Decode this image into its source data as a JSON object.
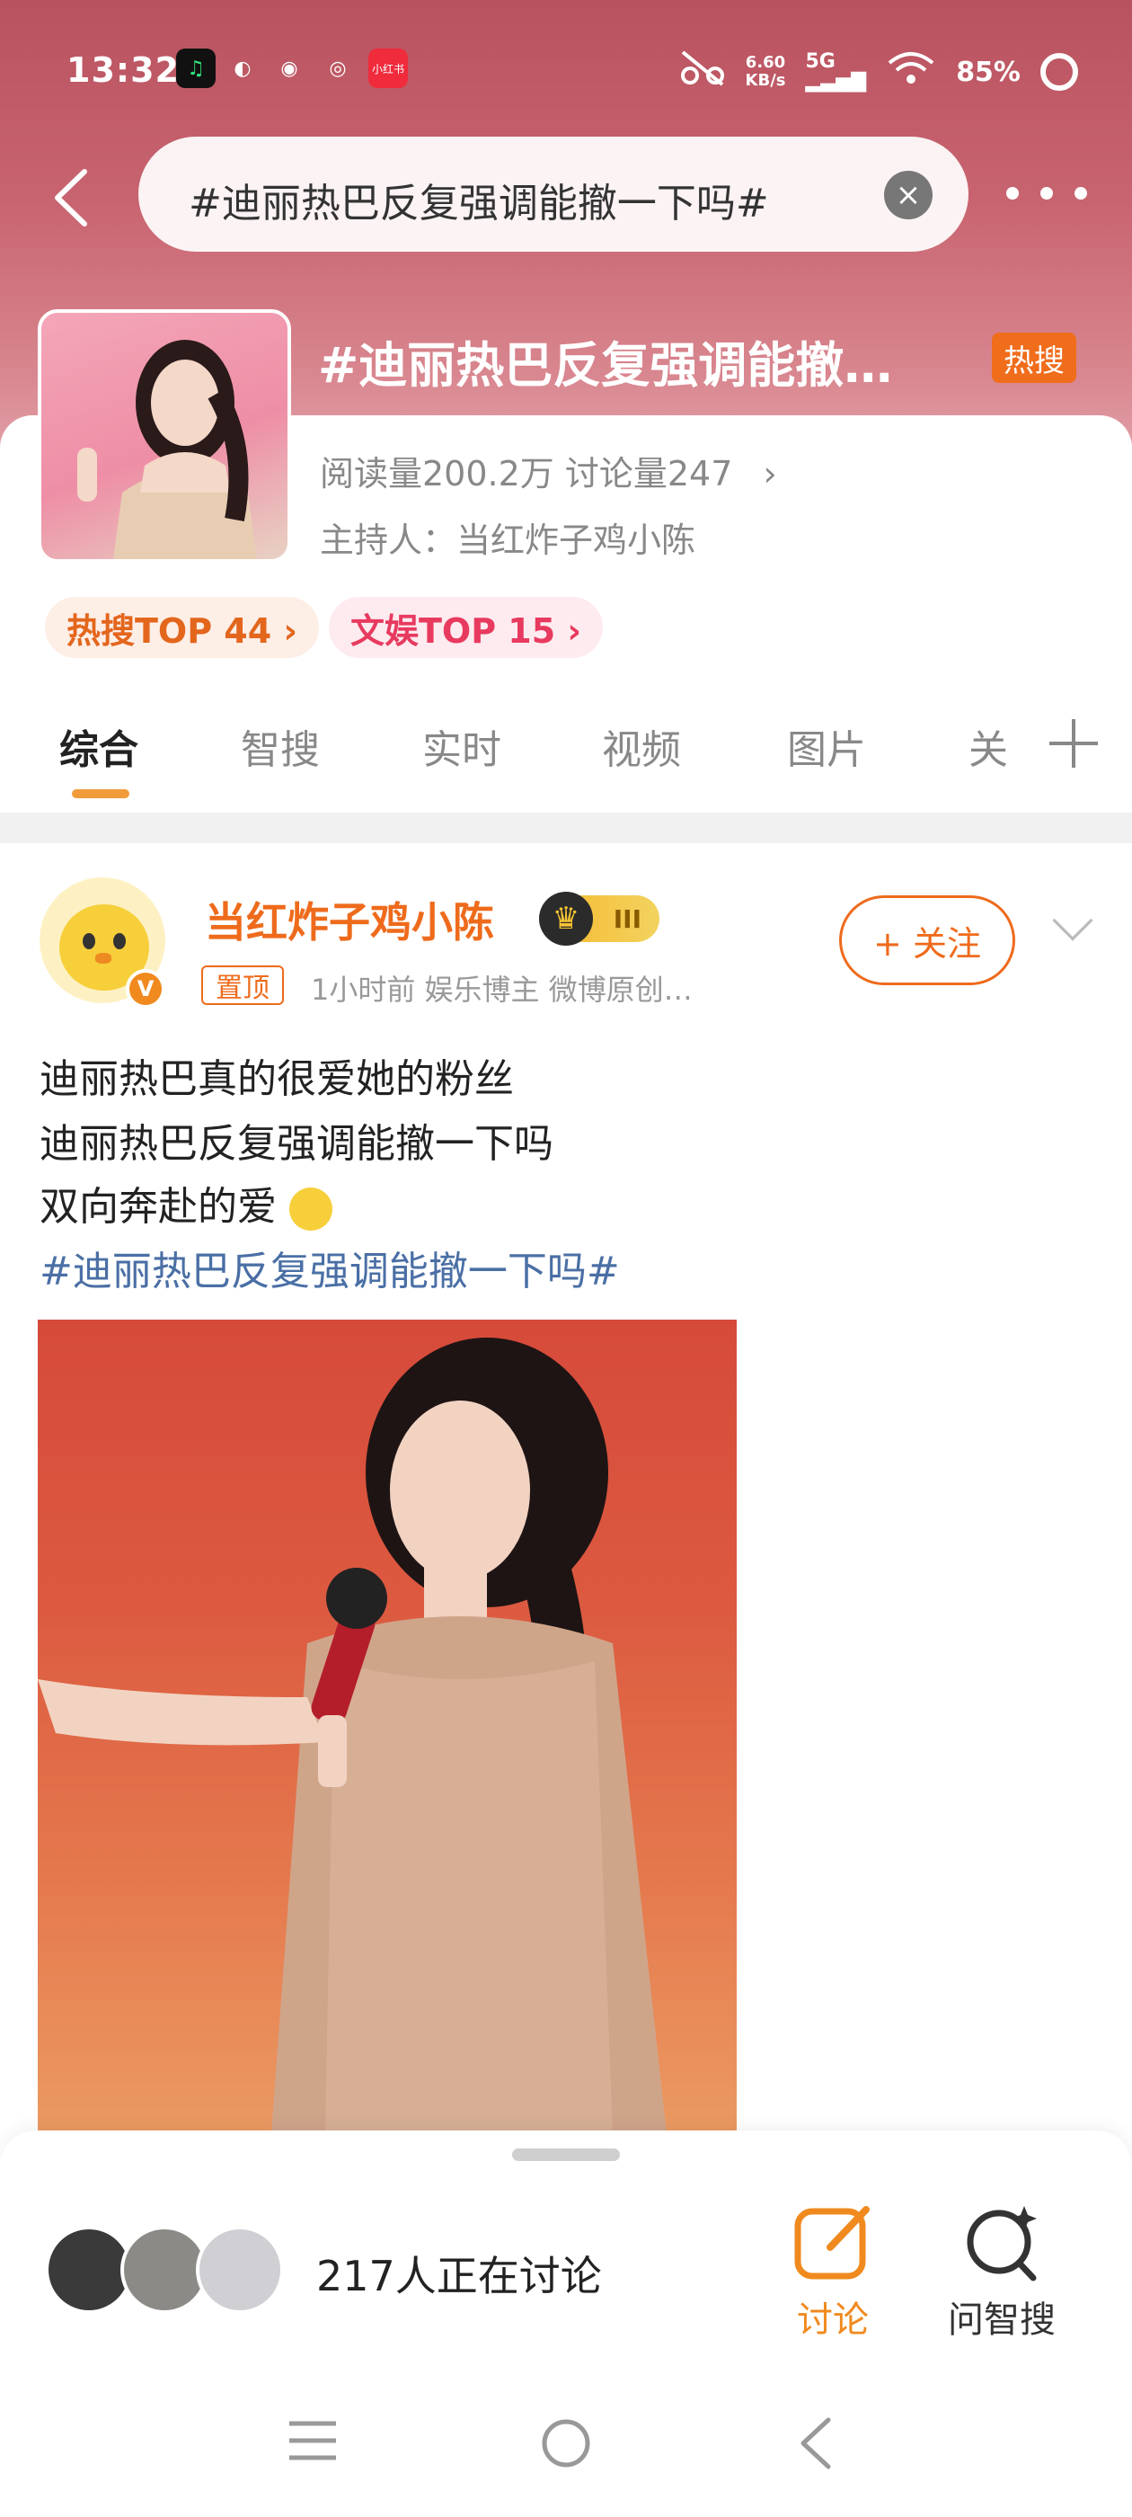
{
  "status_bar": {
    "time": "13:32",
    "net_speed": "6.60",
    "net_unit": "KB/s",
    "network": "5G",
    "battery": "85%",
    "app_icons": [
      "qq-music-icon",
      "mango-icon",
      "wechat-icon",
      "weibo-icon",
      "xiaohongshu-icon"
    ]
  },
  "nav": {
    "search_query": "#迪丽热巴反复强调能撤一下吗#"
  },
  "topic": {
    "title": "#迪丽热巴反复强调能撤…",
    "hot_badge": "热搜",
    "stats": "阅读量200.2万  讨论量247",
    "host": "主持人：当红炸子鸡小陈",
    "rank_chips": [
      "热搜TOP 44 ›",
      "文娱TOP 15 ›"
    ]
  },
  "tabs": [
    "综合",
    "智搜",
    "实时",
    "视频",
    "图片",
    "关"
  ],
  "post": {
    "author": "当红炸子鸡小陈",
    "level": "III",
    "pin_tag": "置顶",
    "meta": "1小时前  娱乐博主 微博原创…",
    "follow_label": "+ 关注",
    "lines": [
      "迪丽热巴真的很爱她的粉丝",
      "迪丽热巴反复强调能撤一下吗",
      "双向奔赴的爱"
    ],
    "hashtag": "#迪丽热巴反复强调能撤一下吗#"
  },
  "bottom": {
    "discussing": "217人正在讨论",
    "discuss_label": "讨论",
    "ask_label": "问智搜"
  },
  "colors": {
    "accent": "#ee6b1c",
    "hot": "#f06d1c",
    "hashtag": "#4a6fa5",
    "header_gradient_top": "#b8525e"
  }
}
